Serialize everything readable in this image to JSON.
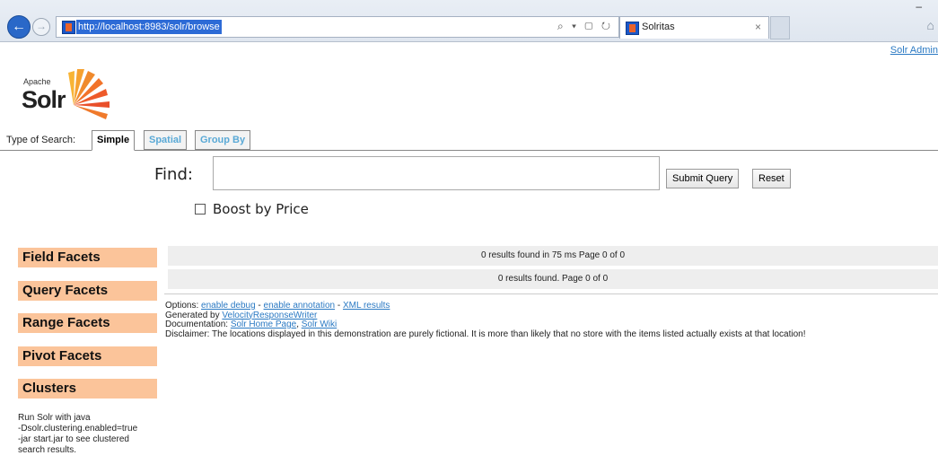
{
  "browser": {
    "url": "http://localhost:8983/solr/browse",
    "tab_title": "Solritas",
    "tab_close": "×",
    "back_glyph": "←",
    "forward_glyph": "→",
    "address_icons": "⌕ ▾ ▢ ↻",
    "home_glyph": "⌂",
    "min_glyph": "–",
    "max_glyph": "–"
  },
  "header": {
    "top_right_link": "Solr Admin",
    "logo_apache": "Apache",
    "logo_solr": "Solr"
  },
  "search_tabs": {
    "label": "Type of Search:",
    "items": [
      "Simple",
      "Spatial",
      "Group By"
    ]
  },
  "search": {
    "find_label": "Find:",
    "query_value": "",
    "submit_label": "Submit Query",
    "reset_label": "Reset",
    "boost_label": "Boost by Price",
    "boost_checked": false
  },
  "facets": {
    "items": [
      "Field Facets",
      "Query Facets",
      "Range Facets",
      "Pivot Facets",
      "Clusters"
    ],
    "accent": "#fbc49a"
  },
  "cluster_note": [
    "Run Solr with java",
    "-Dsolr.clustering.enabled=true",
    "-jar start.jar to see clustered",
    "search results."
  ],
  "results": {
    "summary": "0 results found in 75 ms Page 0 of 0",
    "summary2": "0 results found. Page 0 of 0"
  },
  "footer": {
    "options_label": "Options:",
    "option_links": [
      "enable debug",
      "enable annotation",
      "XML results"
    ],
    "option_sep": " - ",
    "generated_label": "Generated by",
    "generated_link": "VelocityResponseWriter",
    "documentation_label": "Documentation:",
    "doc_links": [
      "Solr Home Page",
      "Solr Wiki"
    ],
    "doc_sep": ", ",
    "disclaimer": "Disclaimer: The locations displayed in this demonstration are purely fictional. It is more than likely that no store with the items listed actually exists at that location!"
  },
  "colors": {
    "link": "#2a79c3",
    "tab_link": "#5aa9d6",
    "result_bar": "#eeeeee"
  }
}
